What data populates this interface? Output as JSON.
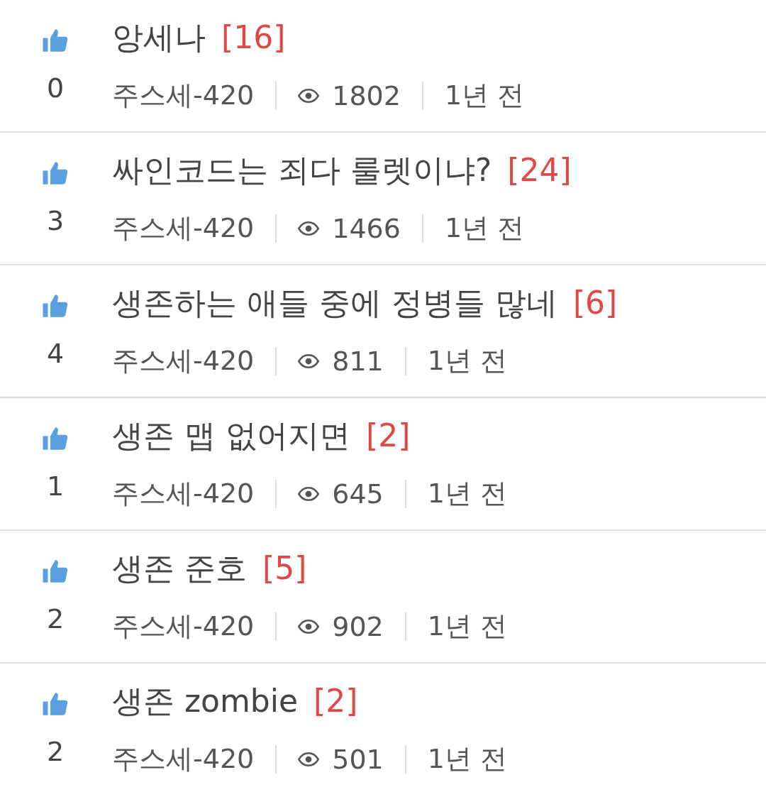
{
  "posts": [
    {
      "title": "앙세나",
      "comments": "[16]",
      "likes": "0",
      "author": "주스세-420",
      "views": "1802",
      "time": "1년 전"
    },
    {
      "title": "싸인코드는 죄다 룰렛이냐?",
      "comments": "[24]",
      "likes": "3",
      "author": "주스세-420",
      "views": "1466",
      "time": "1년 전"
    },
    {
      "title": "생존하는 애들 중에 정병들 많네",
      "comments": "[6]",
      "likes": "4",
      "author": "주스세-420",
      "views": "811",
      "time": "1년 전"
    },
    {
      "title": "생존 맵 없어지면",
      "comments": "[2]",
      "likes": "1",
      "author": "주스세-420",
      "views": "645",
      "time": "1년 전"
    },
    {
      "title": "생존 준호",
      "comments": "[5]",
      "likes": "2",
      "author": "주스세-420",
      "views": "902",
      "time": "1년 전"
    },
    {
      "title": "생존 zombie",
      "comments": "[2]",
      "likes": "2",
      "author": "주스세-420",
      "views": "501",
      "time": "1년 전"
    }
  ]
}
